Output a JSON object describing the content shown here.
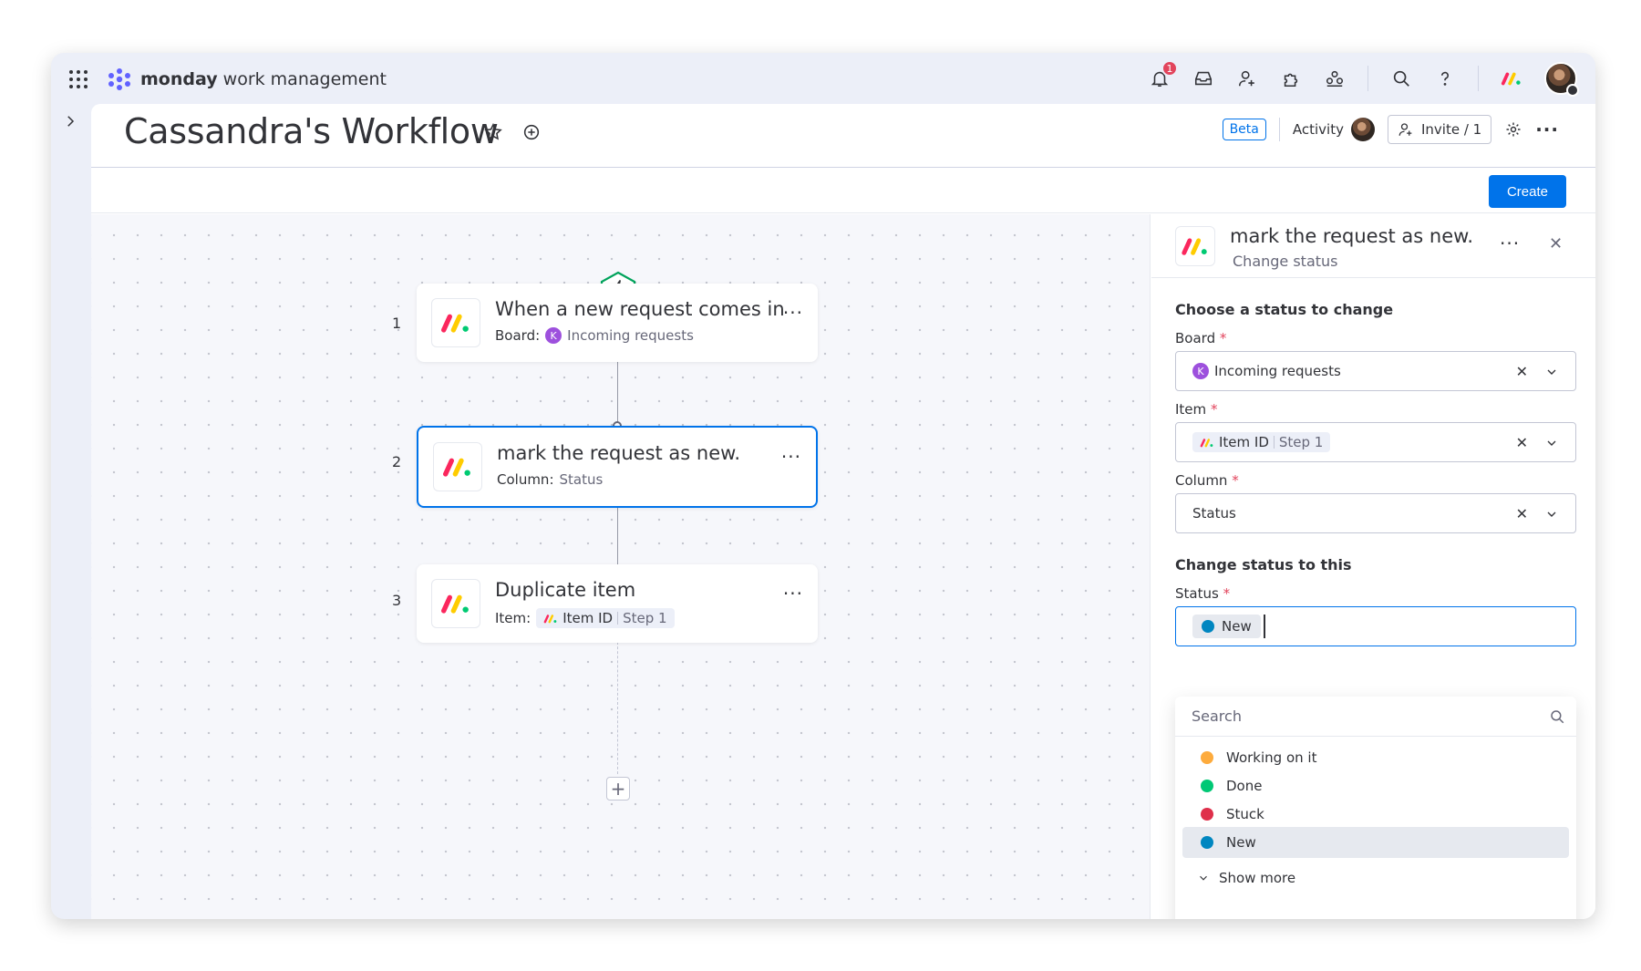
{
  "app": {
    "brand_bold": "monday",
    "brand_light": "work management",
    "notification_count": "1"
  },
  "topbar_icons": [
    "apps-grid-icon",
    "bell-icon",
    "inbox-icon",
    "invite-members-icon",
    "marketplace-icon",
    "people-icon",
    "search-icon",
    "help-icon"
  ],
  "board": {
    "title": "Cassandra's Workflow",
    "beta_label": "Beta",
    "activity_label": "Activity",
    "invite_label": "Invite / 1",
    "create_label": "Create"
  },
  "workflow": {
    "steps": [
      {
        "number": "1",
        "title": "When a new request comes in",
        "sub_label": "Board:",
        "sub_value": "Incoming requests",
        "board_initial": "K"
      },
      {
        "number": "2",
        "title": "mark the request as new.",
        "sub_label": "Column:",
        "sub_value": "Status"
      },
      {
        "number": "3",
        "title": "Duplicate item",
        "sub_label": "Item:",
        "chip_main": "Item ID",
        "chip_step": "Step 1"
      }
    ],
    "more_label": "···",
    "add_label": "+"
  },
  "panel": {
    "title": "mark the request as new.",
    "subtitle": "Change status",
    "section1": "Choose a status to change",
    "board_label": "Board",
    "board_value": "Incoming requests",
    "board_initial": "K",
    "item_label": "Item",
    "item_chip_main": "Item ID",
    "item_chip_step": "Step 1",
    "column_label": "Column",
    "column_value": "Status",
    "section2": "Change status to this",
    "status_label": "Status",
    "status_value": "New",
    "required_mark": "*",
    "clear_mark": "✕"
  },
  "dropdown": {
    "search_placeholder": "Search",
    "options": [
      {
        "label": "Working on it",
        "color": "#fdab3d"
      },
      {
        "label": "Done",
        "color": "#00c875"
      },
      {
        "label": "Stuck",
        "color": "#df2f4a"
      },
      {
        "label": "New",
        "color": "#0086c0"
      }
    ],
    "show_more": "Show more"
  }
}
